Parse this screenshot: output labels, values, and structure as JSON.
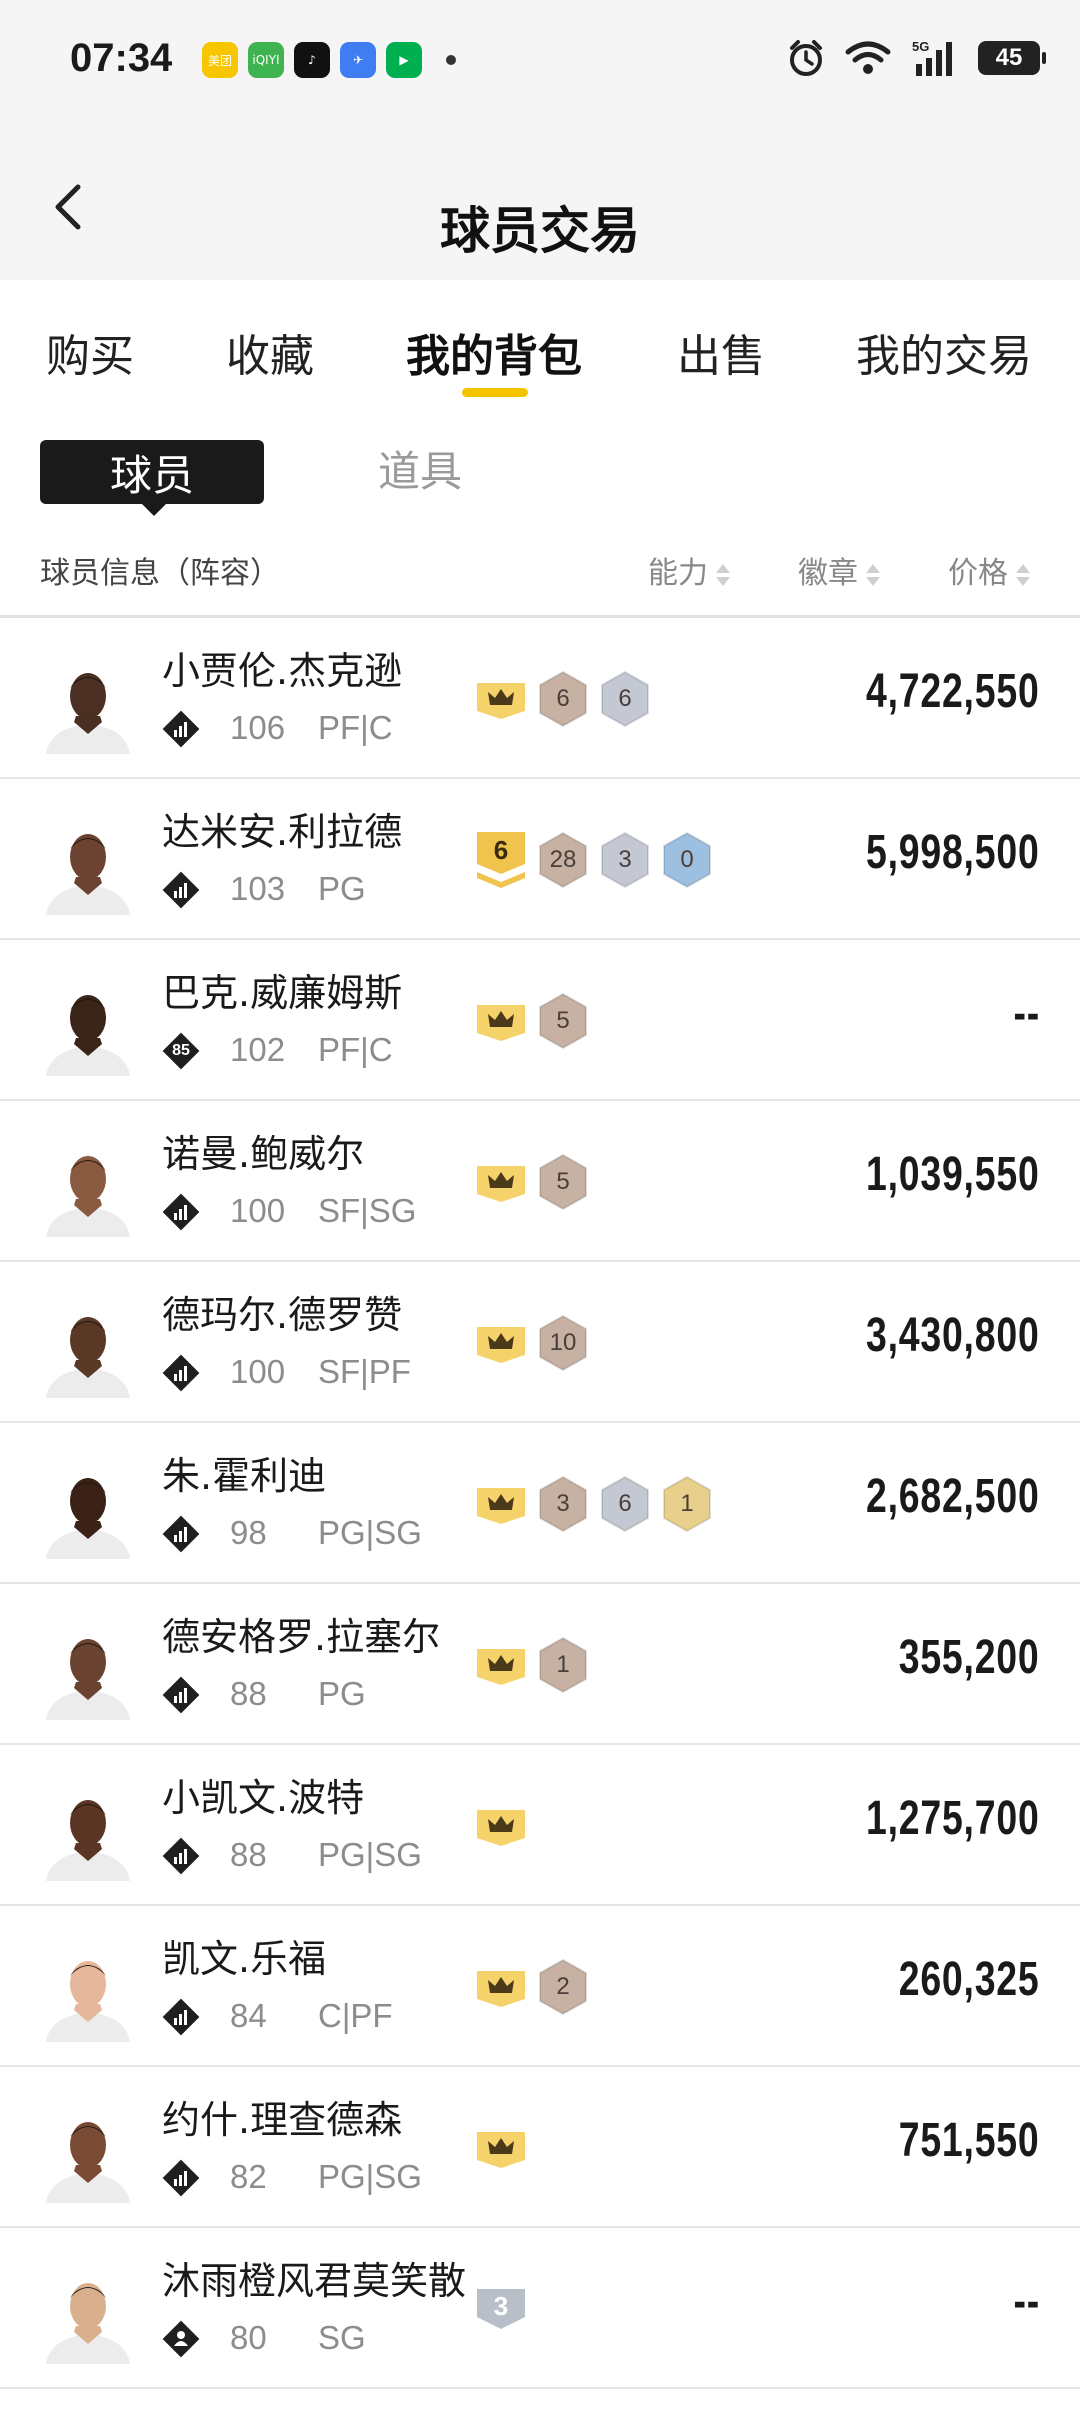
{
  "status": {
    "time": "07:34",
    "battery": "45",
    "apps": [
      {
        "label": "美团",
        "color": "#f7c600",
        "icon": "meituan-icon"
      },
      {
        "label": "iQIYI",
        "color": "#3fb34f",
        "icon": "iqiyi-icon"
      },
      {
        "label": "♪",
        "color": "#111111",
        "icon": "tiktok-icon"
      },
      {
        "label": "✈",
        "color": "#3f7df2",
        "icon": "travel-app-icon"
      },
      {
        "label": "▶",
        "color": "#00b050",
        "icon": "video-app-icon"
      }
    ]
  },
  "header": {
    "title": "球员交易"
  },
  "tabs": [
    "购买",
    "收藏",
    "我的背包",
    "出售",
    "我的交易"
  ],
  "active_tab": "我的背包",
  "segments": {
    "active": "球员",
    "inactive": "道具"
  },
  "columns": {
    "info": "球员信息（阵容）",
    "ability": "能力",
    "badge": "徽章",
    "price": "价格"
  },
  "players": [
    {
      "name": "小贾伦.杰克逊",
      "ability": "106",
      "position": "PF|C",
      "rank": "",
      "badges": [
        {
          "kind": "crown"
        },
        {
          "kind": "hex",
          "color": "bronze",
          "num": "6"
        },
        {
          "kind": "hex",
          "color": "silver",
          "num": "6"
        }
      ],
      "price": "4,722,550"
    },
    {
      "name": "达米安.利拉德",
      "ability": "103",
      "position": "PG",
      "rank": "",
      "badges": [
        {
          "kind": "level",
          "num": "6"
        },
        {
          "kind": "hex",
          "color": "bronze",
          "num": "28"
        },
        {
          "kind": "hex",
          "color": "silver",
          "num": "3"
        },
        {
          "kind": "hex",
          "color": "blue",
          "num": "0"
        }
      ],
      "price": "5,998,500"
    },
    {
      "name": "巴克.威廉姆斯",
      "ability": "102",
      "position": "PF|C",
      "rank": "85",
      "badges": [
        {
          "kind": "crown"
        },
        {
          "kind": "hex",
          "color": "bronze",
          "num": "5"
        }
      ],
      "price": "--"
    },
    {
      "name": "诺曼.鲍威尔",
      "ability": "100",
      "position": "SF|SG",
      "rank": "",
      "badges": [
        {
          "kind": "crown"
        },
        {
          "kind": "hex",
          "color": "bronze",
          "num": "5"
        }
      ],
      "price": "1,039,550"
    },
    {
      "name": "德玛尔.德罗赞",
      "ability": "100",
      "position": "SF|PF",
      "rank": "",
      "badges": [
        {
          "kind": "crown"
        },
        {
          "kind": "hex",
          "color": "bronze",
          "num": "10"
        }
      ],
      "price": "3,430,800"
    },
    {
      "name": "朱.霍利迪",
      "ability": "98",
      "position": "PG|SG",
      "rank": "",
      "badges": [
        {
          "kind": "crown"
        },
        {
          "kind": "hex",
          "color": "bronze",
          "num": "3"
        },
        {
          "kind": "hex",
          "color": "silver",
          "num": "6"
        },
        {
          "kind": "hex",
          "color": "gold",
          "num": "1"
        }
      ],
      "price": "2,682,500"
    },
    {
      "name": "德安格罗.拉塞尔",
      "ability": "88",
      "position": "PG",
      "rank": "",
      "badges": [
        {
          "kind": "crown"
        },
        {
          "kind": "hex",
          "color": "bronze",
          "num": "1"
        }
      ],
      "price": "355,200"
    },
    {
      "name": "小凯文.波特",
      "ability": "88",
      "position": "PG|SG",
      "rank": "",
      "badges": [
        {
          "kind": "crown"
        }
      ],
      "price": "1,275,700"
    },
    {
      "name": "凯文.乐福",
      "ability": "84",
      "position": "C|PF",
      "rank": "",
      "badges": [
        {
          "kind": "crown"
        },
        {
          "kind": "hex",
          "color": "bronze",
          "num": "2"
        }
      ],
      "price": "260,325"
    },
    {
      "name": "约什.理查德森",
      "ability": "82",
      "position": "PG|SG",
      "rank": "",
      "badges": [
        {
          "kind": "crown"
        }
      ],
      "price": "751,550"
    },
    {
      "name": "沐雨橙风君莫笑散",
      "ability": "80",
      "position": "SG",
      "rank": "",
      "badges": [
        {
          "kind": "shield",
          "num": "3"
        }
      ],
      "price": "--"
    }
  ],
  "colors": {
    "accent": "#f5c400",
    "crown": "#f6d36a",
    "bronze": "#c6b1a2",
    "silver": "#c3c8d3",
    "blue": "#9dbfe0",
    "gold": "#e9cf8c"
  }
}
